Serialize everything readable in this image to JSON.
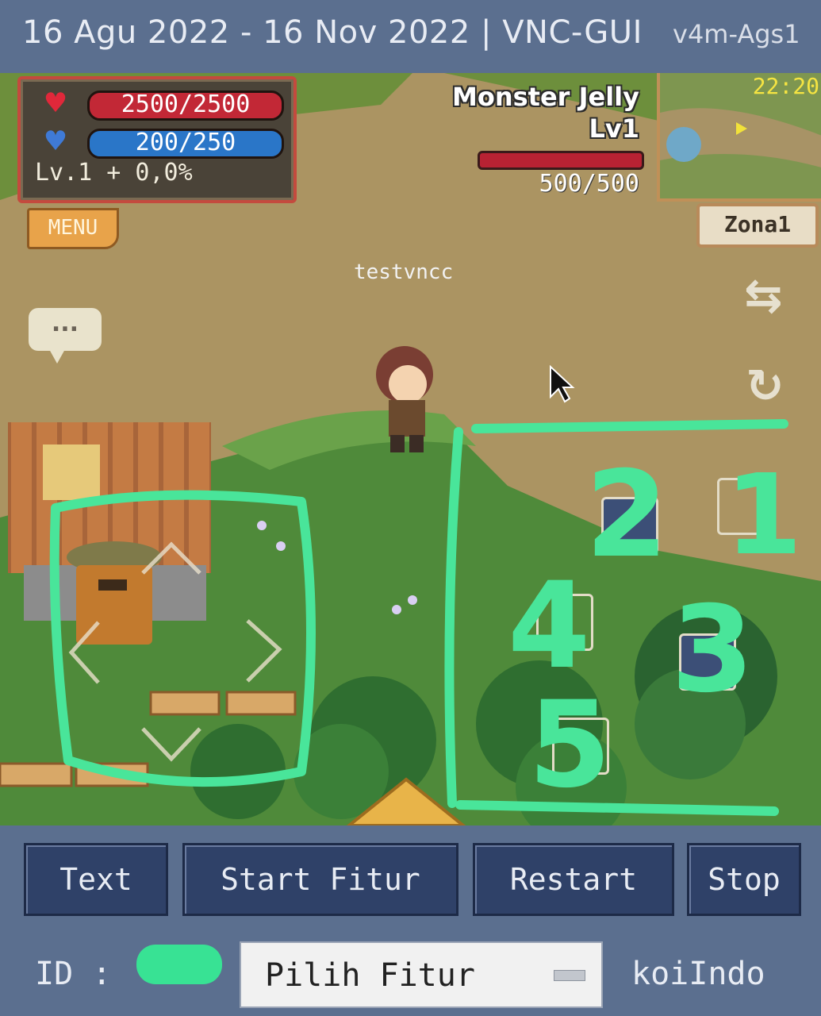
{
  "titlebar": {
    "period": "16 Agu 2022 - 16 Nov 2022 | VNC-GUI",
    "version": "v4m-Ags1"
  },
  "game": {
    "hp": "2500/2500",
    "mp": "200/250",
    "level": "Lv.1 + 0,0%",
    "menu_label": "MENU",
    "chat_label": "...",
    "monster_name": "Monster Jelly",
    "monster_level": "Lv1",
    "monster_hp": "500/500",
    "clock": "22:20",
    "zone": "Zona1",
    "player_name": "testvncc",
    "annotations": [
      "1",
      "2",
      "3",
      "4",
      "5"
    ]
  },
  "controls": {
    "buttons": [
      "Text",
      "Start Fitur",
      "Restart",
      "Stop"
    ],
    "id_label": "ID :",
    "select_value": "Pilih Fitur",
    "brand": "koiIndo"
  },
  "colors": {
    "annotation": "#49e59a",
    "panel": "#5b6f8f",
    "button": "#2f4168"
  }
}
